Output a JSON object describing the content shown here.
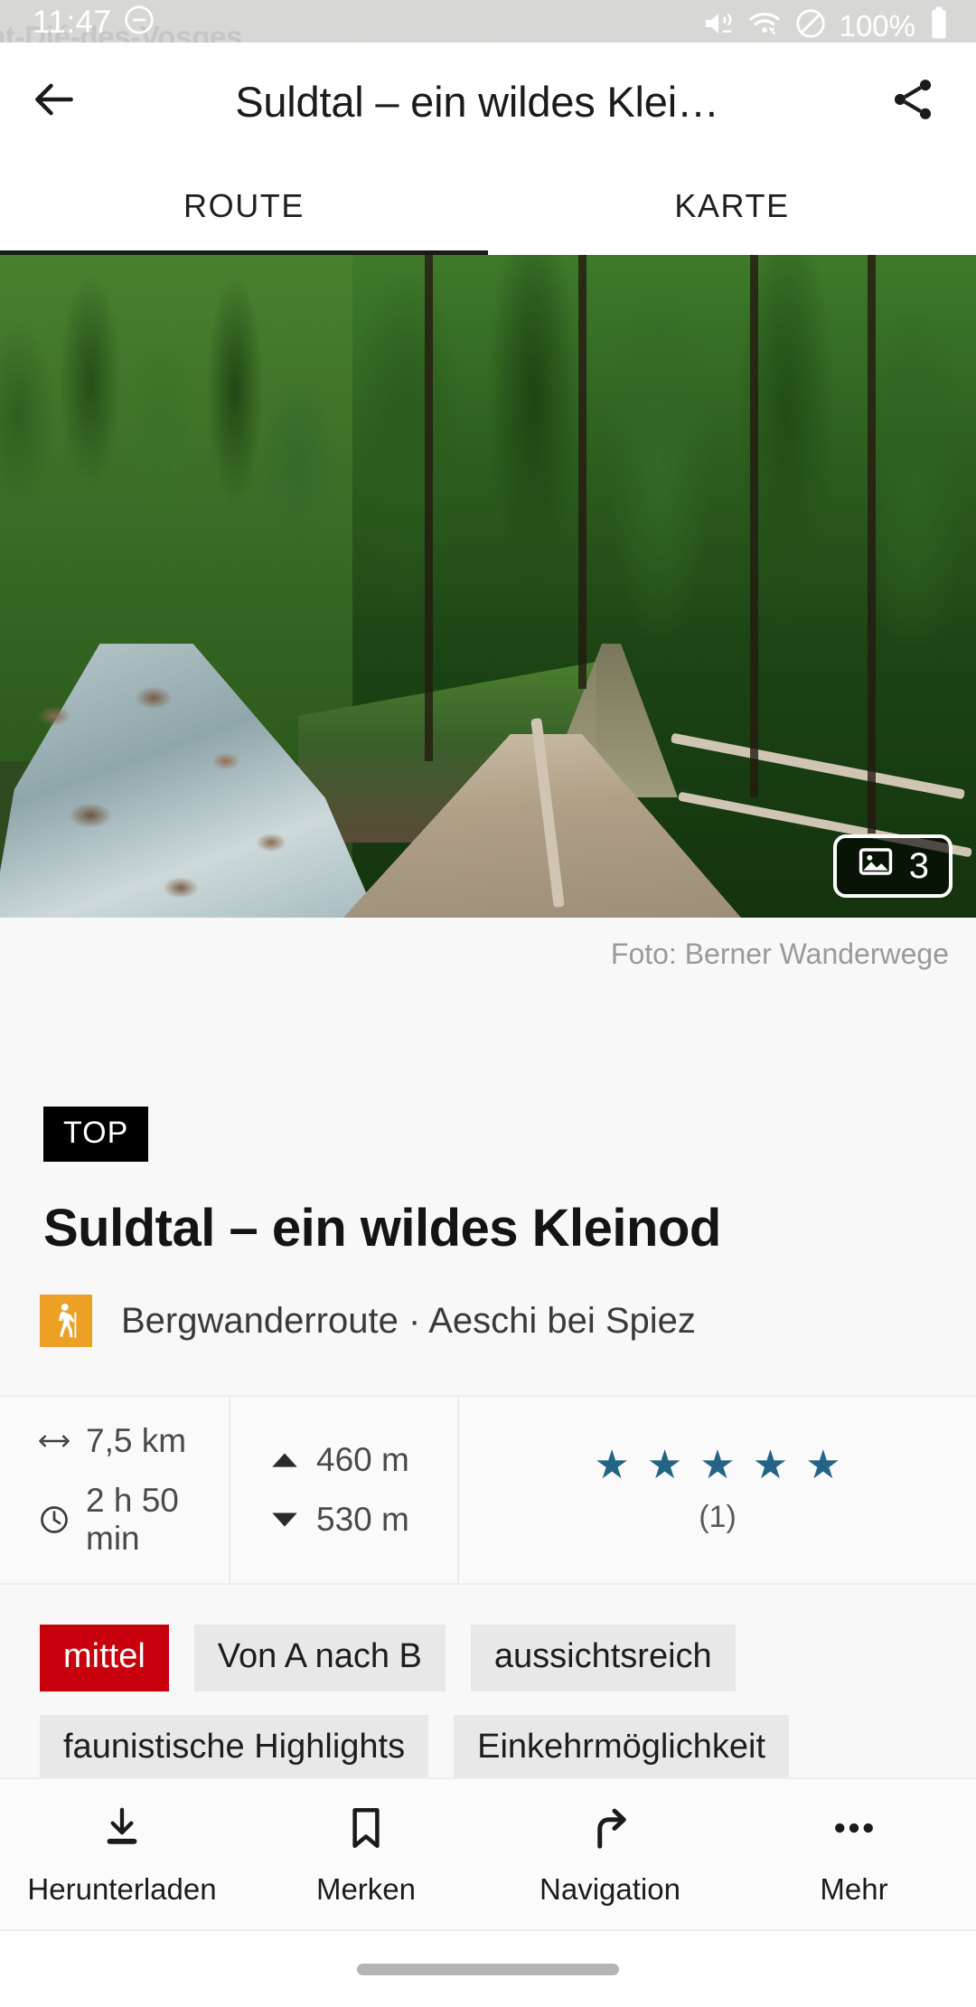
{
  "status_bar": {
    "time": "11:47",
    "dnd_icon": "do-not-disturb-icon",
    "background_map_label": "nt-Dié-des-Vosges",
    "mute_icon": "volume-muted-icon",
    "wifi_icon": "wifi-icon",
    "block_icon": "no-entry-icon",
    "battery_percent": "100%",
    "battery_icon": "battery-full-icon"
  },
  "app_bar": {
    "back_icon": "back-arrow-icon",
    "title": "Suldtal – ein wildes Klei…",
    "share_icon": "share-icon"
  },
  "tabs": [
    {
      "label": "ROUTE",
      "active": true
    },
    {
      "label": "KARTE",
      "active": false
    }
  ],
  "hero": {
    "photo_count": "3",
    "photo_count_icon": "image-icon",
    "credit": "Foto: Berner Wanderwege"
  },
  "detail": {
    "top_badge": "TOP",
    "title": "Suldtal – ein wildes Kleinod",
    "activity_icon": "hiker-icon",
    "subtitle": "Bergwanderroute · Aeschi bei Spiez"
  },
  "stats": {
    "distance_icon": "distance-arrows-icon",
    "distance": "7,5 km",
    "duration_icon": "clock-icon",
    "duration": "2 h 50 min",
    "ascent_icon": "ascent-triangle-up-icon",
    "ascent": "460 m",
    "descent_icon": "descent-triangle-down-icon",
    "descent": "530 m",
    "stars_filled": 5,
    "star_glyph": "★",
    "star_color": "#246586",
    "rating_count": "(1)"
  },
  "tags": [
    {
      "label": "mittel",
      "type": "difficulty",
      "color": "#c8000d"
    },
    {
      "label": "Von A nach B",
      "type": "normal"
    },
    {
      "label": "aussichtsreich",
      "type": "normal"
    },
    {
      "label": "faunistische Highlights",
      "type": "normal"
    },
    {
      "label": "Einkehrmöglichkeit",
      "type": "normal"
    }
  ],
  "bottom_bar": [
    {
      "label": "Herunterladen",
      "icon": "download-icon"
    },
    {
      "label": "Merken",
      "icon": "bookmark-icon"
    },
    {
      "label": "Navigation",
      "icon": "navigation-arrow-icon"
    },
    {
      "label": "Mehr",
      "icon": "more-dots-icon"
    }
  ]
}
